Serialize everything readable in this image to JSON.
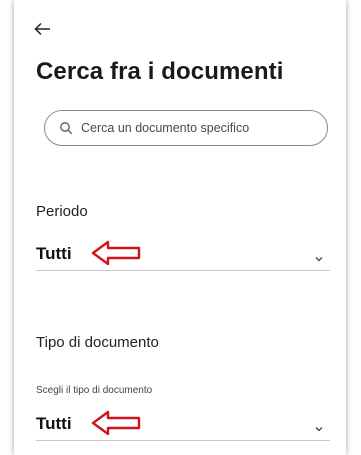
{
  "page": {
    "title": "Cerca fra i documenti"
  },
  "nav": {
    "back_icon": "arrow-left-icon"
  },
  "search": {
    "placeholder": "Cerca un documento specifico",
    "value": "",
    "icon": "search-icon"
  },
  "filters": {
    "periodo": {
      "label": "Periodo",
      "value": "Tutti",
      "icon": "chevron-down-icon"
    },
    "tipo": {
      "label": "Tipo di documento",
      "sublabel": "Scegli il tipo di documento",
      "value": "Tutti",
      "icon": "chevron-down-icon"
    }
  },
  "annotations": {
    "arrow_color": "#d0141c",
    "arrow_icon": "red-left-arrow-annotation"
  },
  "colors": {
    "background": "#ffffff",
    "text": "#1a1a1a",
    "border": "#8a8a8a"
  }
}
